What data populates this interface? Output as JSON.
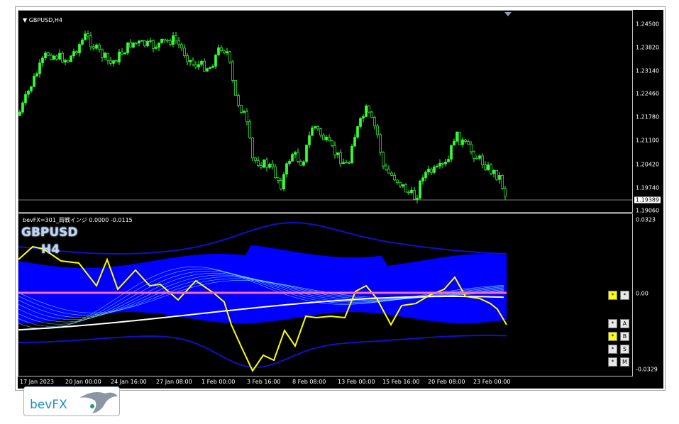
{
  "window": {
    "symbol_label": "GBPUSD,H4"
  },
  "main_scale": {
    "ticks": [
      "1.24500",
      "1.23820",
      "1.23140",
      "1.22460",
      "1.21780",
      "1.21100",
      "1.20420",
      "1.19740",
      "1.19060"
    ],
    "current_price": "1.19389"
  },
  "indicator": {
    "title": "bevFX=301_局戦インジ 0.0000 -0.0115",
    "symbol": "GBPUSD",
    "timeframe": "H4",
    "ticks": [
      "0.0323",
      "0.00",
      "-0.0329"
    ]
  },
  "time_axis": [
    "17 Jan 2023",
    "20 Jan 00:00",
    "24 Jan 16:00",
    "27 Jan 08:00",
    "1 Feb 00:00",
    "3 Feb 16:00",
    "8 Feb 08:00",
    "13 Feb 00:00",
    "15 Feb 16:00",
    "20 Feb 08:00",
    "23 Feb 00:00"
  ],
  "side_buttons": [
    {
      "left": "*",
      "right": "*"
    },
    {
      "left": "*",
      "right": "A"
    },
    {
      "left": "*",
      "right": "B"
    },
    {
      "left": "*",
      "right": "S"
    },
    {
      "left": "*",
      "right": "M"
    }
  ],
  "logo": {
    "text": "bevFX"
  },
  "colors": {
    "candle": "#33ff33",
    "band": "#0000ff",
    "band_line": "#1010c8",
    "zero_line": "#ff69b4",
    "yellow_line": "#ffff00",
    "white_line": "#ffffff",
    "cyan_fan": "#7fe8ff"
  }
}
